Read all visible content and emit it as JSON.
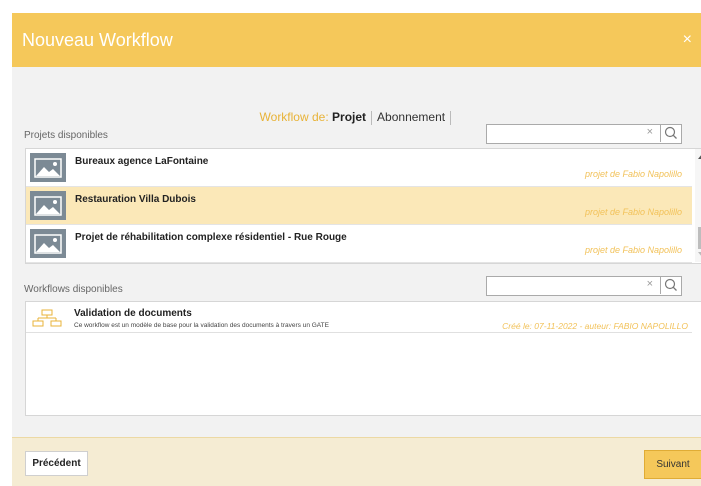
{
  "dialog": {
    "title": "Nouveau Workflow",
    "close_icon": "×"
  },
  "tabs": {
    "label": "Workflow de:",
    "items": [
      "Projet",
      "Abonnement"
    ],
    "active": "Projet"
  },
  "projects": {
    "label": "Projets disponibles",
    "search_value": "",
    "clear_icon": "×",
    "items": [
      {
        "name": "Bureaux agence LaFontaine",
        "author": "projet de Fabio Napolillo",
        "selected": false
      },
      {
        "name": "Restauration Villa Dubois",
        "author": "projet de Fabio Napolillo",
        "selected": true
      },
      {
        "name": "Projet de réhabilitation complexe résidentiel - Rue Rouge",
        "author": "projet de Fabio Napolillo",
        "selected": false
      }
    ]
  },
  "workflows": {
    "label": "Workflows disponibles",
    "search_value": "",
    "clear_icon": "×",
    "items": [
      {
        "name": "Validation de documents",
        "description": "Ce workflow est un modèle de base pour la validation des documents à travers un GATE",
        "meta": "Créé le: 07-11-2022 - auteur: FABIO NAPOLILLO"
      }
    ]
  },
  "footer": {
    "prev_label": "Précédent",
    "next_label": "Suivant"
  },
  "colors": {
    "accent": "#f5c85a",
    "selected_row": "#fbe8b8",
    "author_text": "#f2c25a"
  }
}
